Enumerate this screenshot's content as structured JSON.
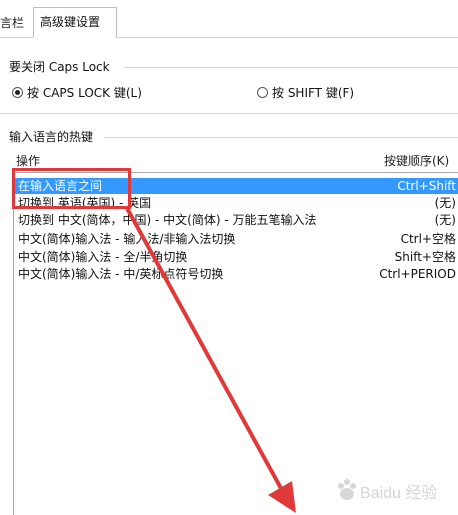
{
  "tabs": [
    {
      "label": "言栏",
      "active": false
    },
    {
      "label": "高级键设置",
      "active": true
    }
  ],
  "caps_group": {
    "title": "要关闭 Caps Lock",
    "options": [
      {
        "label": "按 CAPS LOCK 键(L)",
        "checked": true
      },
      {
        "label": "按 SHIFT 键(F)",
        "checked": false
      }
    ]
  },
  "hotkeys": {
    "title": "输入语言的热键",
    "col_action": "操作",
    "col_keys": "按键顺序(K)",
    "rows": [
      {
        "name": "在输入语言之间",
        "keys": "Ctrl+Shift",
        "selected": true
      },
      {
        "name": "切换到 英语(英国) - 英国",
        "keys": "(无)",
        "selected": false
      },
      {
        "name": "切换到 中文(简体，中国) - 中文(简体) - 万能五笔输入法",
        "keys": "(无)",
        "selected": false
      },
      {
        "name": "中文(简体)输入法 - 输入法/非输入法切换",
        "keys": "Ctrl+空格",
        "selected": false
      },
      {
        "name": "中文(简体)输入法 - 全/半角切换",
        "keys": "Shift+空格",
        "selected": false
      },
      {
        "name": "中文(简体)输入法 - 中/英标点符号切换",
        "keys": "Ctrl+PERIOD",
        "selected": false
      }
    ]
  },
  "watermark": "Baidu 经验",
  "colors": {
    "selection": "#3399ff",
    "annotation": "#e0393a"
  }
}
